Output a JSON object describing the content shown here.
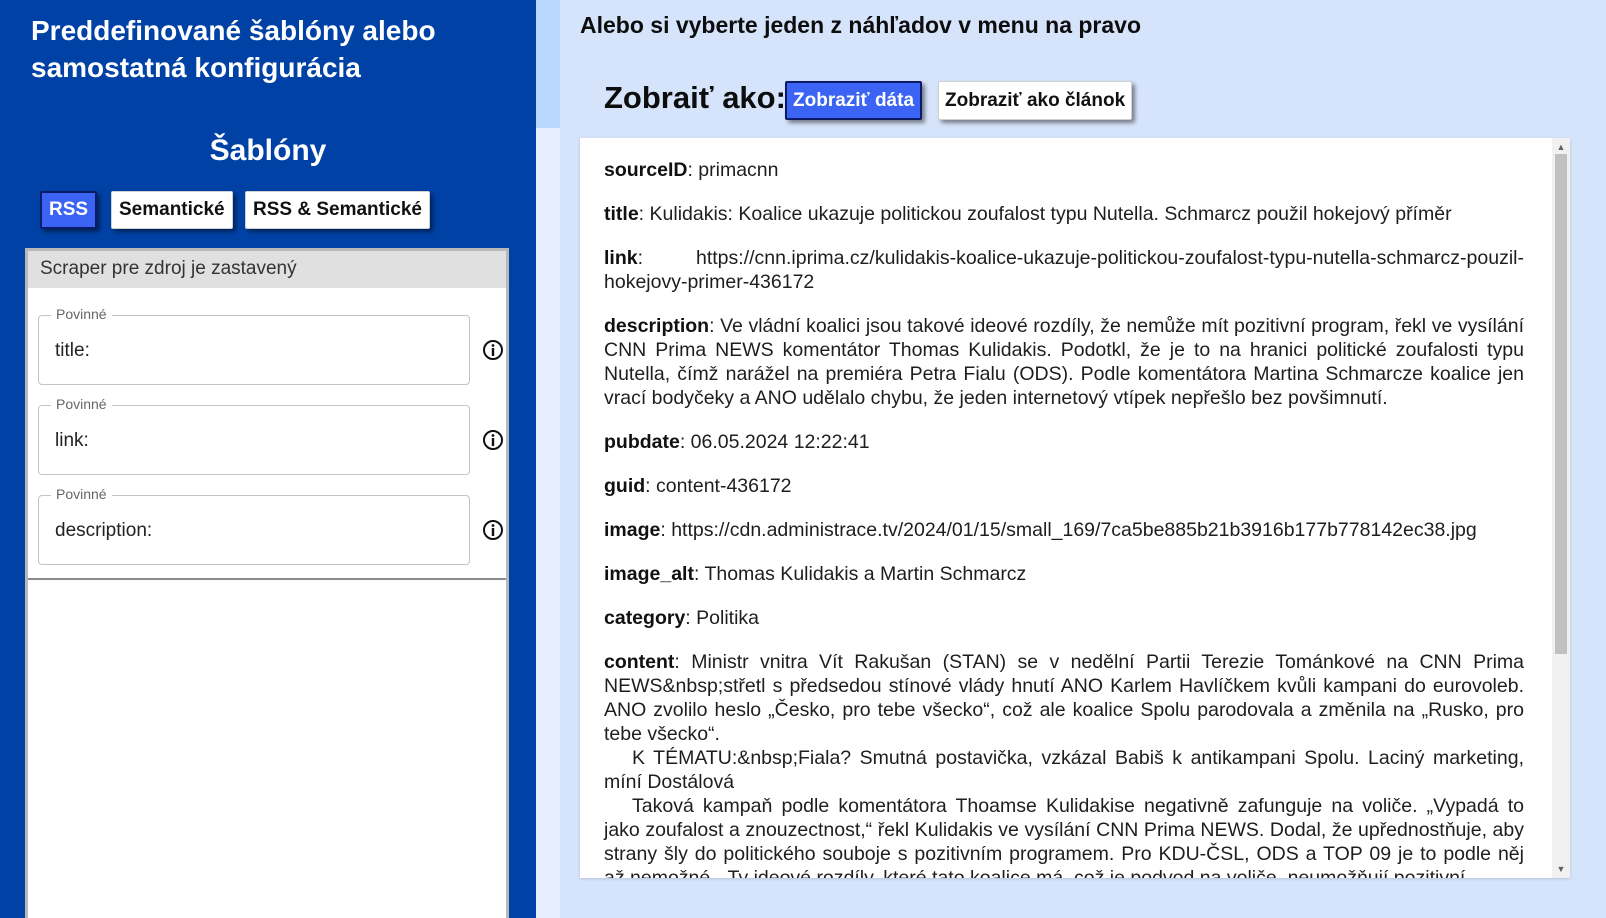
{
  "left": {
    "title": "Preddefinované šablóny alebo samostatná konfigurácia",
    "templates_heading": "Šablóny",
    "template_buttons": [
      "RSS",
      "Semantické",
      "RSS & Semantické"
    ],
    "scraper_status": "Scraper pre zdroj je zastavený",
    "fields": [
      {
        "legend": "Povinné",
        "value": "title:"
      },
      {
        "legend": "Povinné",
        "value": "link:"
      },
      {
        "legend": "Povinné",
        "value": "description:"
      }
    ]
  },
  "right": {
    "heading": "Alebo si vyberte jeden z náhľadov v menu na pravo",
    "show_label": "Zobraiť ako:",
    "view_buttons": [
      "Zobraziť dáta",
      "Zobraziť ako článok"
    ],
    "items": [
      {
        "key": "sourceID",
        "value": ": primacnn"
      },
      {
        "key": "title",
        "value": ": Kulidakis: Koalice ukazuje politickou zoufalost typu Nutella. Schmarcz použil hokejový příměr"
      },
      {
        "key": "link",
        "value": ":   https://cnn.iprima.cz/kulidakis-koalice-ukazuje-politickou-zoufalost-typu-nutella-schmarcz-pouzil-hokejovy-primer-436172"
      },
      {
        "key": "description",
        "value": ": Ve vládní koalici jsou takové ideové rozdíly, že nemůže mít pozitivní program, řekl ve vysílání CNN Prima NEWS komentátor Thomas Kulidakis. Podotkl, že je to na hranici politické zoufalosti typu Nutella, čímž narážel na premiéra Petra Fialu (ODS). Podle komentátora Martina Schmarcze koalice jen vrací bodyčeky a ANO udělalo chybu, že jeden internetový vtípek nepřešlo bez povšimnutí."
      },
      {
        "key": "pubdate",
        "value": ": 06.05.2024 12:22:41"
      },
      {
        "key": "guid",
        "value": ": content-436172"
      },
      {
        "key": "image",
        "value": ": https://cdn.administrace.tv/2024/01/15/small_169/7ca5be885b21b3916b177b778142ec38.jpg"
      },
      {
        "key": "image_alt",
        "value": ": Thomas Kulidakis a Martin Schmarcz"
      },
      {
        "key": "category",
        "value": ": Politika"
      }
    ],
    "content_key": "content",
    "content_lines": [
      ": Ministr vnitra Vít Rakušan (STAN) se v nedělní Partii Terezie Tománkové na CNN Prima NEWS&nbsp;střetl s předsedou stínové vlády hnutí ANO Karlem Havlíčkem kvůli kampani do eurovoleb. ANO zvolilo heslo „Česko, pro tebe všecko“, což ale koalice Spolu parodovala a změnila na „Rusko, pro tebe všecko“.",
      "K TÉMATU:&nbsp;Fiala? Smutná postavička, vzkázal Babiš k antikampani Spolu. Laciný marketing, míní Dostálová",
      "Taková kampaň podle komentátora Thoamse Kulidakise negativně zafunguje na voliče. „Vypadá to jako zoufalost a znouzectnost,“ řekl Kulidakis ve vysílání CNN Prima NEWS. Dodal, že upřednostňuje, aby strany šly do politického souboje s pozitivním programem. Pro KDU-ČSL, ODS a TOP 09 je to podle něj až nemožné. „Ty ideové rozdíly, které tato koalice má, což je podvod na voliče, neumožňují pozitivní"
    ]
  },
  "colors": {
    "left_bg": "#0041a6",
    "page_bg": "#d6e4fb",
    "active_button": "#3b64f4"
  },
  "icons": [
    "info-icon",
    "scroll-up-arrow-icon",
    "scroll-down-arrow-icon"
  ]
}
